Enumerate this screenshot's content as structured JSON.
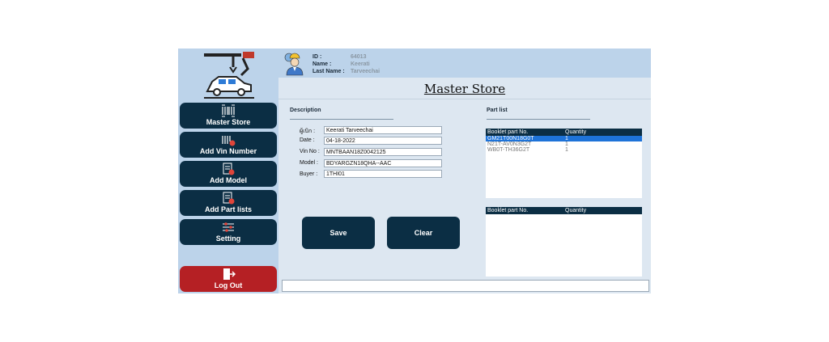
{
  "sidebar": {
    "nav": [
      {
        "label": "Master Store",
        "icon": "barcode-icon"
      },
      {
        "label": "Add Vin Number",
        "icon": "barcode-add-icon"
      },
      {
        "label": "Add Model",
        "icon": "document-add-icon"
      },
      {
        "label": "Add Part lists",
        "icon": "document-add-icon"
      },
      {
        "label": "Setting",
        "icon": "sliders-icon"
      }
    ],
    "logout": {
      "label": "Log Out",
      "icon": "logout-icon"
    }
  },
  "header": {
    "id_label": "ID :",
    "id_value": "64013",
    "name_label": "Name :",
    "name_value": "Keerati",
    "lastname_label": "Last Name :",
    "lastname_value": "Tarveechai"
  },
  "page": {
    "title": "Master Store"
  },
  "description": {
    "heading": "Description",
    "fields": [
      {
        "label": "ผู้เบิก :",
        "value": "Keerati Tarveechai"
      },
      {
        "label": "Date :",
        "value": "04-18-2022"
      },
      {
        "label": "Vin No :",
        "value": "MNTBAAN18Z0042125"
      },
      {
        "label": "Model :",
        "value": "BDYARGZN18QHA--AAC"
      },
      {
        "label": "Buyer :",
        "value": "1THI01"
      }
    ]
  },
  "buttons": {
    "save": "Save",
    "clear": "Clear"
  },
  "partlist": {
    "heading": "Part list",
    "columns": [
      "Booklet part No.",
      "Quantity"
    ],
    "rows": [
      {
        "part": "GM21T00N18G0T",
        "qty": "1",
        "selected": true
      },
      {
        "part": "N21T-AV0N3G2T",
        "qty": "1",
        "selected": false
      },
      {
        "part": "WB0T-TH36G2T",
        "qty": "1",
        "selected": false
      }
    ],
    "second_columns": [
      "Booklet part No.",
      "Quantity"
    ]
  },
  "colors": {
    "nav": "#0b2e44",
    "logout": "#b52024",
    "sidebar": "#bcd3ea",
    "selected": "#1e73d8"
  }
}
